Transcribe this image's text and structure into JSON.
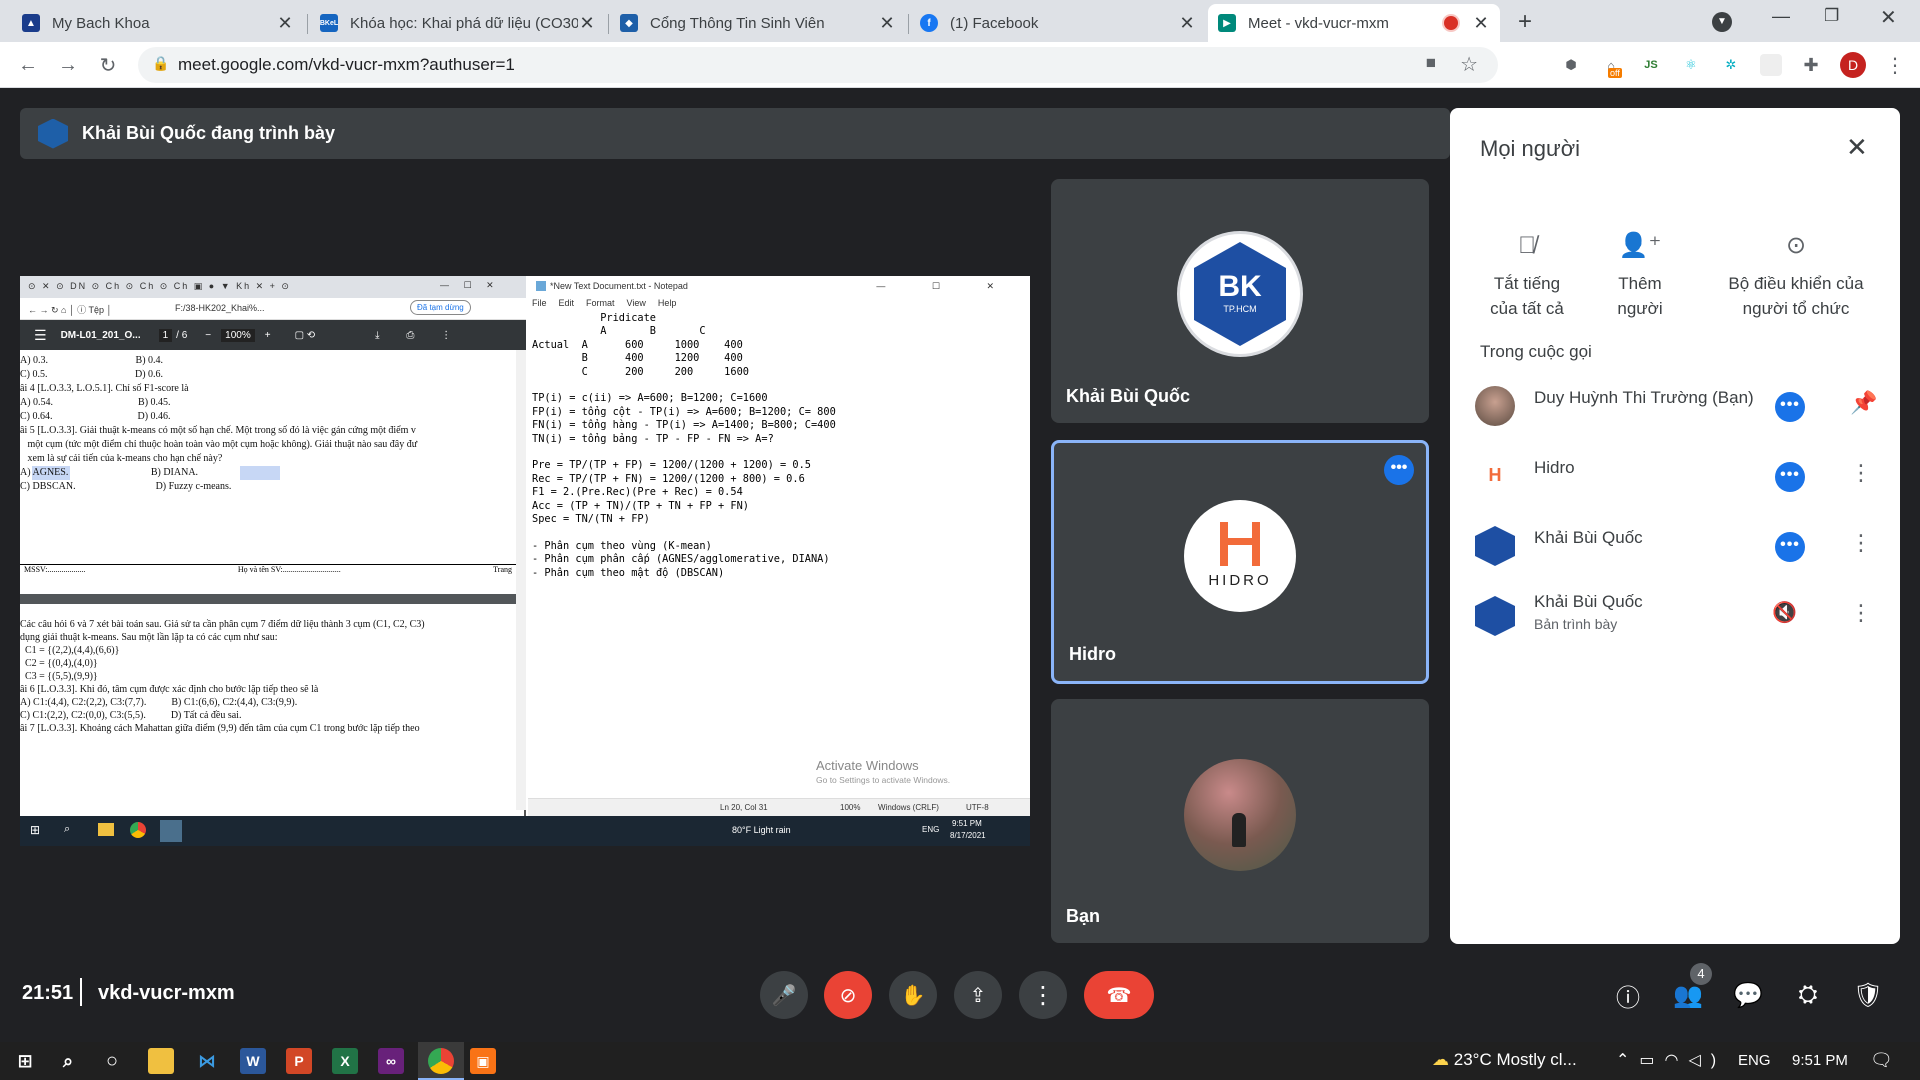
{
  "browser": {
    "tabs": [
      {
        "title": "My Bach Khoa",
        "icon": "bk-shield-icon",
        "color": "#1a3c8b"
      },
      {
        "title": "Khóa học: Khai phá dữ liệu (CO30",
        "icon": "bkel-icon",
        "color": "#1565c0"
      },
      {
        "title": "Cổng Thông Tin Sinh Viên",
        "icon": "bk-logo-icon",
        "color": "#1e5fa8"
      },
      {
        "title": "(1) Facebook",
        "icon": "facebook-icon",
        "color": "#1877f2"
      },
      {
        "title": "Meet - vkd-vucr-mxm",
        "icon": "meet-icon",
        "color": "#00897b"
      }
    ],
    "url": "meet.google.com/vkd-vucr-mxm?authuser=1",
    "profile_initial": "D",
    "ext_badge": "off"
  },
  "meet": {
    "presenting_banner": "Khải Bùi Quốc đang trình bày",
    "time": "21:51",
    "meeting_code": "vkd-vucr-mxm",
    "participant_count": "4",
    "tiles": [
      {
        "name": "Khải Bùi Quốc",
        "logo_text": "BK",
        "logo_sub": "TP.HCM"
      },
      {
        "name": "Hidro",
        "logo_text": "HIDRO"
      },
      {
        "name": "Bạn"
      }
    ],
    "people_panel": {
      "title": "Mọi người",
      "actions": [
        "Tắt tiếng\ncủa tất cả",
        "Thêm\nngười",
        "Bộ điều khiển của\nngười tổ chức"
      ],
      "section": "Trong cuộc gọi",
      "participants": [
        {
          "name": "Duy Huỳnh Thi Trường (Bạn)",
          "sub": ""
        },
        {
          "name": "Hidro",
          "sub": ""
        },
        {
          "name": "Khải Bùi Quốc",
          "sub": ""
        },
        {
          "name": "Khải Bùi Quốc",
          "sub": "Bản trình bày"
        }
      ]
    }
  },
  "shared_screen": {
    "pdf_toolbar": {
      "doc": "DM-L01_201_O...",
      "page": "1",
      "pages": "/ 6",
      "zoom": "100%",
      "address": "F:/38-HK202_Khai%...",
      "paused": "Đã tạm dừng"
    },
    "pdf_lines": [
      "A) 0.3.                                   B) 0.4.",
      "C) 0.5.                                   D) 0.6.",
      "âi 4 [L.O.3.3, L.O.5.1]. Chỉ số F1-score là",
      "A) 0.54.                                  B) 0.45.",
      "C) 0.64.                                  D) 0.46.",
      "âi 5 [L.O.3.3]. Giải thuật k-means có một số hạn chế. Một trong số đó là việc gán cứng một điểm v",
      "   một cụm (tức một điểm chỉ thuộc hoàn toàn vào một cụm hoặc không). Giải thuật nào sau đây đư",
      "   xem là sự cải tiến của k-means cho hạn chế này?",
      "A) AGNES.                                 B) DIANA.",
      "C) DBSCAN.                                D) Fuzzy c-means."
    ],
    "pdf_footer": {
      "mssv": "MSSV:...................",
      "name": "Họ và tên SV:.............................",
      "page": "Trang"
    },
    "pdf_lines2": [
      "Các câu hỏi 6 và 7 xét bài toán sau. Giả sử ta cần phân cụm 7 điểm dữ liệu thành 3 cụm (C1, C2, C3)",
      "dụng giải thuật k-means. Sau một lần lặp ta có các cụm như sau:",
      "  C1 = {(2,2),(4,4),(6,6)}",
      "  C2 = {(0,4),(4,0)}",
      "  C3 = {(5,5),(9,9)}",
      "âi 6 [L.O.3.3]. Khi đó, tâm cụm được xác định cho bước lặp tiếp theo sẽ là",
      "A) C1:(4,4), C2:(2,2), C3:(7,7).          B) C1:(6,6), C2:(4,4), C3:(9,9).",
      "C) C1:(2,2), C2:(0,0), C3:(5,5).          D) Tất cả đều sai.",
      "âi 7 [L.O.3.3]. Khoảng cách Mahattan giữa điểm (9,9) đến tâm của cụm C1 trong bước lặp tiếp theo"
    ],
    "notepad": {
      "title": "*New Text Document.txt - Notepad",
      "menu": [
        "File",
        "Edit",
        "Format",
        "View",
        "Help"
      ],
      "text": "           Pridicate\n           A       B       C\nActual  A      600     1000    400\n        B      400     1200    400\n        C      200     200     1600\n\nTP(i) = c(ii) => A=600; B=1200; C=1600\nFP(i) = tổng cột - TP(i) => A=600; B=1200; C= 800\nFN(i) = tổng hàng - TP(i) => A=1400; B=800; C=400\nTN(i) = tổng bảng - TP - FP - FN => A=?\n\nPre = TP/(TP + FP) = 1200/(1200 + 1200) = 0.5\nRec = TP/(TP + FN) = 1200/(1200 + 800) = 0.6\nF1 = 2.(Pre.Rec)(Pre + Rec) = 0.54\nAcc = (TP + TN)/(TP + TN + FP + FN)\nSpec = TN/(TN + FP)\n\n- Phân cụm theo vùng (K-mean)\n- Phân cụm phân cấp (AGNES/agglomerative, DIANA)\n- Phân cụm theo mật độ (DBSCAN)",
      "watermark1": "Activate Windows",
      "watermark2": "Go to Settings to activate Windows.",
      "status": [
        "Ln 20, Col 31",
        "100%",
        "Windows (CRLF)",
        "UTF-8"
      ]
    },
    "taskbar": {
      "weather": "80°F  Light rain",
      "lang": "ENG",
      "time": "9:51 PM",
      "date": "8/17/2021"
    }
  },
  "win_taskbar": {
    "weather": "23°C  Mostly cl...",
    "lang": "ENG",
    "time": "9:51 PM"
  }
}
